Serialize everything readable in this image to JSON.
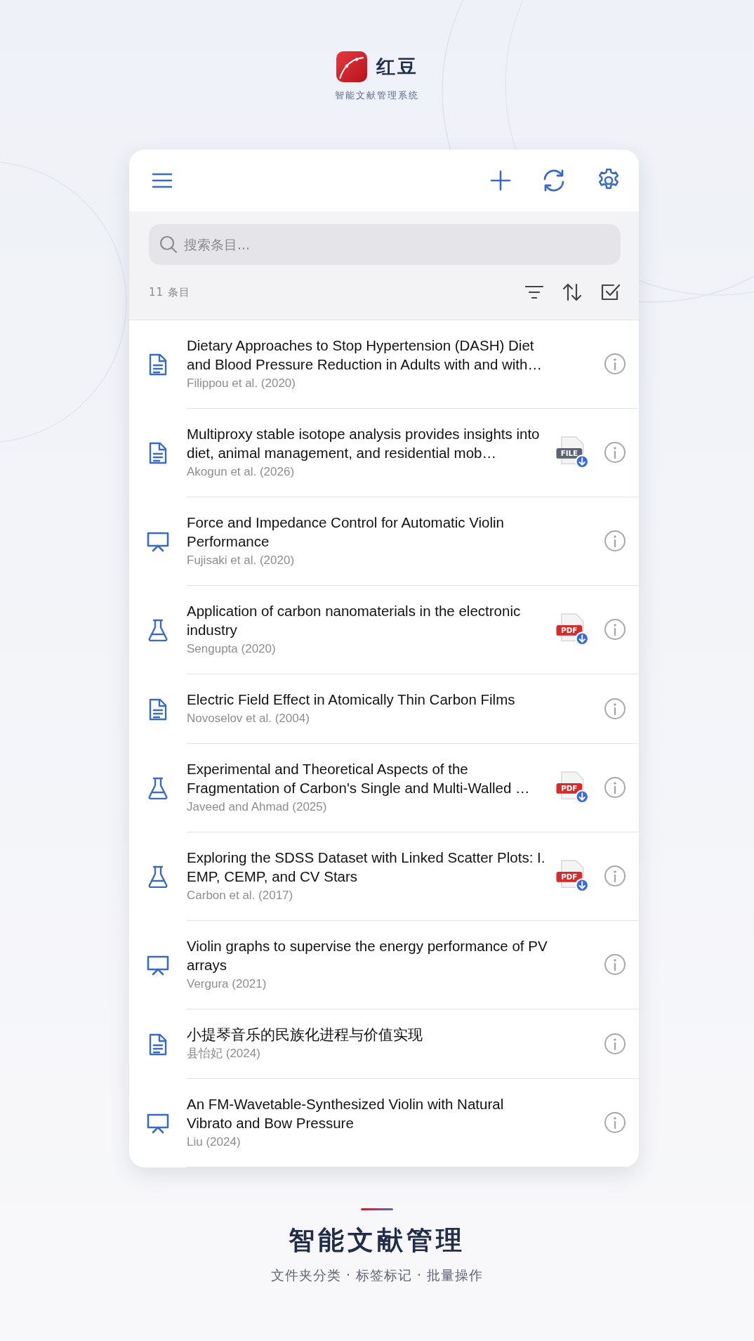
{
  "brand": {
    "name": "红豆",
    "tagline": "智能文献管理系统"
  },
  "search": {
    "placeholder": "搜索条目..."
  },
  "item_count": "11 条目",
  "items": [
    {
      "kind": "document",
      "title": "Dietary Approaches to Stop Hypertension (DASH) Diet and Blood Pressure Reduction  in Adults with and with…",
      "authors": "Filippou et al. (2020)"
    },
    {
      "kind": "document",
      "title": "Multiproxy stable isotope analysis provides insights into diet, animal management, and residential mob…",
      "authors": "Akogun et al. (2026)",
      "attachment": {
        "kind": "file",
        "label": "FILE"
      }
    },
    {
      "kind": "presentation",
      "title": "Force and Impedance Control for Automatic Violin Performance",
      "authors": "Fujisaki et al. (2020)"
    },
    {
      "kind": "experiment",
      "title": "Application of carbon nanomaterials in the electronic industry",
      "authors": "Sengupta (2020)",
      "attachment": {
        "kind": "pdf",
        "label": "PDF"
      }
    },
    {
      "kind": "document",
      "title": "Electric Field Effect in Atomically Thin Carbon Films",
      "authors": "Novoselov et al. (2004)"
    },
    {
      "kind": "experiment",
      "title": "Experimental and Theoretical Aspects of the Fragmentation of Carbon's Single and Multi-Walled …",
      "authors": "Javeed and Ahmad (2025)",
      "attachment": {
        "kind": "pdf",
        "label": "PDF"
      }
    },
    {
      "kind": "experiment",
      "title": "Exploring the SDSS Dataset with Linked Scatter Plots: I. EMP, CEMP, and CV Stars",
      "authors": "Carbon et al. (2017)",
      "attachment": {
        "kind": "pdf",
        "label": "PDF"
      }
    },
    {
      "kind": "presentation",
      "title": "Violin graphs to supervise the energy performance of PV arrays",
      "authors": "Vergura (2021)"
    },
    {
      "kind": "document",
      "title": "小提琴音乐的民族化进程与价值实现",
      "authors": "县怡妃 (2024)"
    },
    {
      "kind": "presentation",
      "title": "An FM-Wavetable-Synthesized Violin with Natural Vibrato and Bow Pressure",
      "authors": "Liu (2024)"
    }
  ],
  "footer": {
    "heading": "智能文献管理",
    "features": "文件夹分类 · 标签标记 · 批量操作"
  }
}
